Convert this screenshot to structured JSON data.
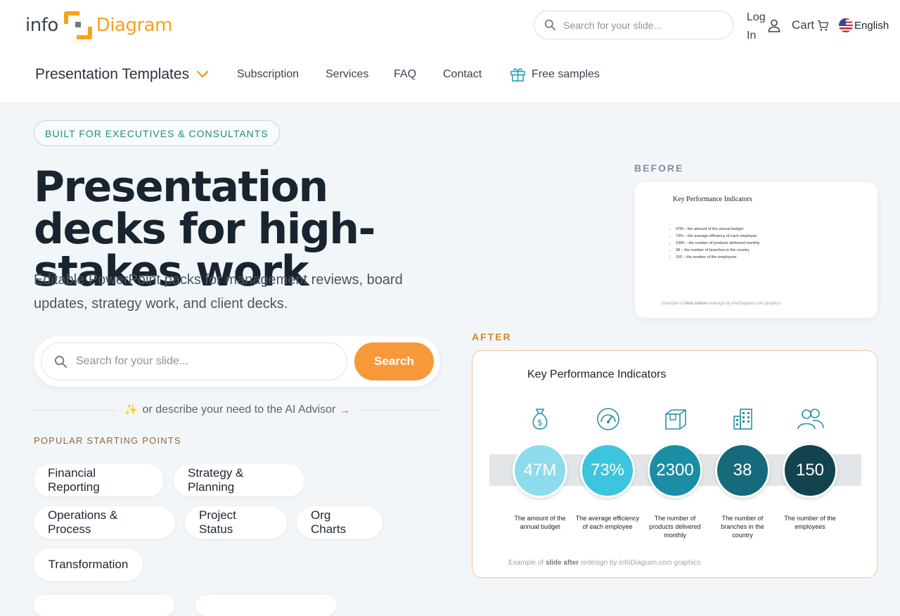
{
  "header": {
    "logo_left": "info",
    "logo_right": "Diagram",
    "search_placeholder": "Search for your slide...",
    "login_label": "Log In",
    "cart_label": "Cart",
    "language_label": "English"
  },
  "nav": {
    "main_label": "Presentation Templates",
    "items": [
      "Subscription",
      "Services",
      "FAQ",
      "Contact"
    ],
    "free_samples_label": "Free samples"
  },
  "hero": {
    "badge": "BUILT FOR EXECUTIVES & CONSULTANTS",
    "title": "Presentation decks for high-stakes work",
    "subtitle": "Editable PowerPoint packs for management reviews, board updates, strategy work, and client decks.",
    "search_placeholder": "Search for your slide...",
    "search_button": "Search",
    "ai_spark": "✨",
    "ai_text": "or describe your need to the AI Advisor",
    "ai_arrow": "→",
    "popular_label": "POPULAR STARTING POINTS",
    "chips": [
      "Financial Reporting",
      "Strategy & Planning",
      "Operations & Process",
      "Project Status",
      "Org Charts",
      "Transformation"
    ]
  },
  "before": {
    "label": "BEFORE",
    "slide_title": "Key Performance Indicators",
    "bullets": [
      "47M – the amount of the annual budget",
      "73% – the average efficiency of each employee",
      "2300 – the number of products delivered monthly",
      "38 – the number of branches in the country",
      "150 – the number of the employees"
    ],
    "foot_prefix": "Example of ",
    "foot_bold": "slide before",
    "foot_suffix": " redesign by infoDiagram.com graphics"
  },
  "after": {
    "label": "AFTER",
    "slide_title": "Key Performance Indicators",
    "kpis": [
      {
        "value": "47M",
        "desc": "The amount of the annual budget",
        "icon": "money-bag-icon",
        "color": "#8ddcee"
      },
      {
        "value": "73%",
        "desc": "The average efficiency of each employee",
        "icon": "gauge-icon",
        "color": "#3cc5dc"
      },
      {
        "value": "2300",
        "desc": "The number of products delivered monthly",
        "icon": "box-icon",
        "color": "#1b8ea6"
      },
      {
        "value": "38",
        "desc": "The number of branches in the country",
        "icon": "building-icon",
        "color": "#176a7c"
      },
      {
        "value": "150",
        "desc": "The number of the employees",
        "icon": "people-icon",
        "color": "#12434e"
      }
    ],
    "foot_prefix": "Example of ",
    "foot_bold": "slide after",
    "foot_suffix": " redesign by infoDiagram.com graphics"
  },
  "colors": {
    "accent_orange": "#f7993a",
    "teal_badge": "#1e8c89",
    "icon_teal": "#2a8fa3"
  }
}
